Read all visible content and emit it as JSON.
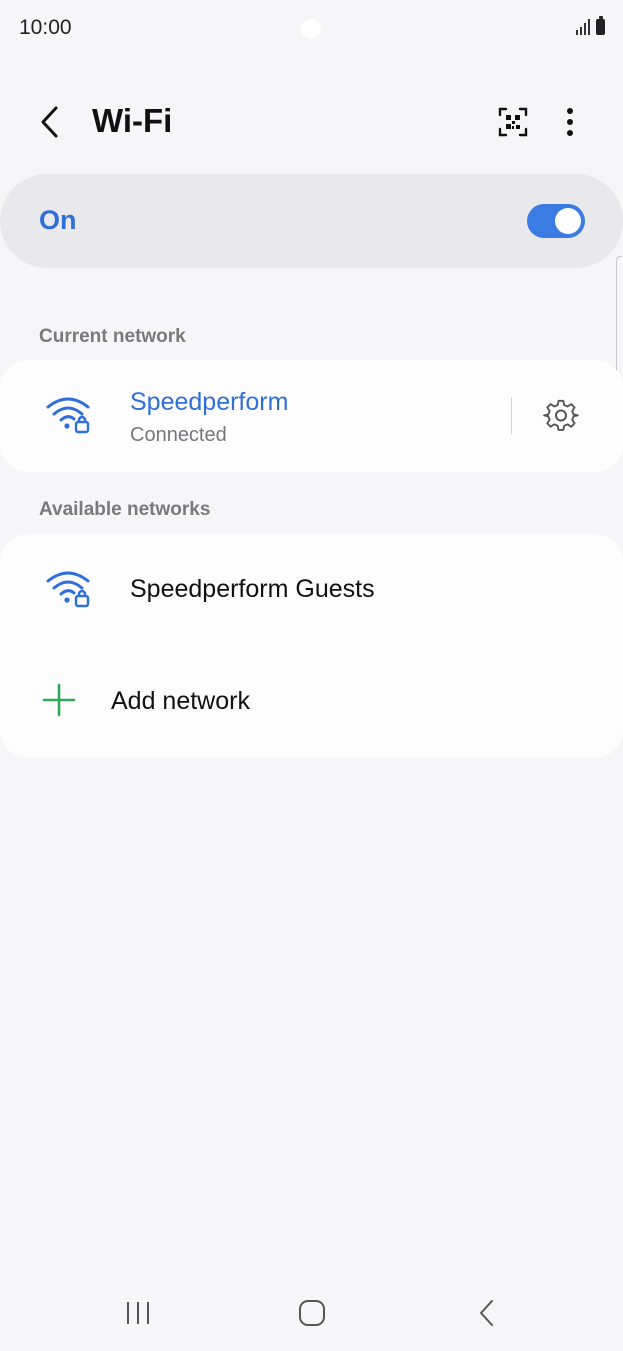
{
  "status_bar": {
    "time": "10:00",
    "icons": [
      "signal-icon",
      "battery-icon"
    ]
  },
  "header": {
    "title": "Wi-Fi",
    "actions": [
      "back-icon",
      "qr-scanner-icon",
      "more-options-icon"
    ]
  },
  "wifi_toggle": {
    "label": "On",
    "enabled": true
  },
  "current_network": {
    "section_label": "Current network",
    "name": "Speedperform",
    "status": "Connected",
    "icons": [
      "wifi-lock-icon",
      "gear-icon"
    ]
  },
  "available_networks": {
    "section_label": "Available networks",
    "items": [
      {
        "name": "Speedperform Guests",
        "icon": "wifi-lock-icon"
      }
    ],
    "add_network_label": "Add network"
  },
  "navigation_bar": {
    "buttons": [
      "recents-icon",
      "home-icon",
      "back-icon"
    ]
  },
  "colors": {
    "accent": "#2f6fd8",
    "toggle_on": "#3a7ce3",
    "add_icon": "#2fa85a",
    "background": "#f6f6f8",
    "toggle_card": "#e9e9ed",
    "card": "#fdfdfe"
  }
}
